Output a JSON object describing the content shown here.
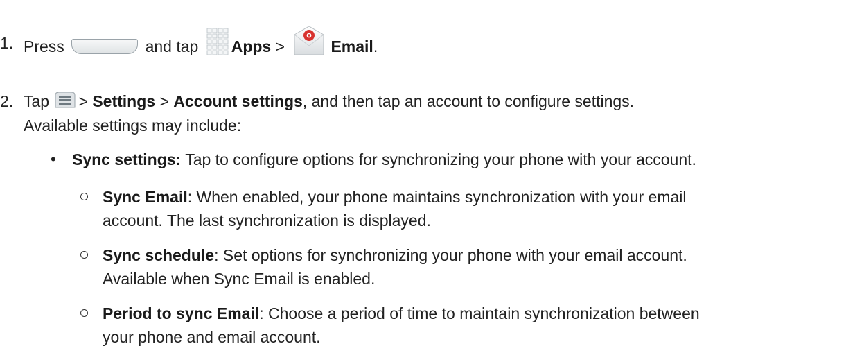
{
  "step1": {
    "num": "1.",
    "press": "Press",
    "and_tap": "and tap",
    "apps": "Apps",
    "sep": ">",
    "email": "Email",
    "end": "."
  },
  "step2": {
    "num": "2.",
    "tap": "Tap",
    "sep1": ">",
    "settings": "Settings",
    "sep2": ">",
    "account_settings": "Account settings",
    "rest": ", and then tap an account to configure settings.",
    "line2": "Available settings may include:"
  },
  "bullet": {
    "marker": "•",
    "title": "Sync settings:",
    "text": "Tap to configure options for synchronizing your phone with your account."
  },
  "sub_items": [
    {
      "title": "Sync Email",
      "text1": ": When enabled, your phone maintains synchronization with your email",
      "text2": "account. The last synchronization is displayed."
    },
    {
      "title": "Sync schedule",
      "text1": ": Set options for synchronizing your phone with your email account.",
      "text2": "Available when Sync Email is enabled."
    },
    {
      "title": "Period to sync Email",
      "text1": ": Choose a period of time to maintain synchronization between",
      "text2": "your phone and email account."
    }
  ],
  "icons": {
    "home_key": "home-key-icon",
    "apps": "apps-grid-icon",
    "email": "email-app-icon",
    "menu": "menu-key-icon"
  }
}
